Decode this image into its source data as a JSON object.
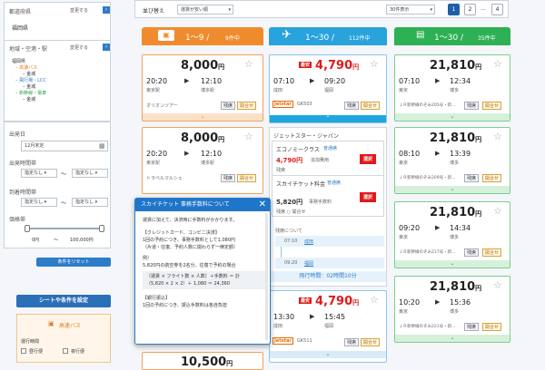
{
  "sidebar": {
    "dep_pref_label": "都道府県",
    "dep_change": "変更する",
    "dep_value": "福岡県",
    "area_label": "地域・空港・駅",
    "area_change": "変更する",
    "tree": [
      "福岡県",
      "高速バス",
      "金城",
      "飛行場・LCC",
      "金城",
      "新幹線・電車",
      "金城"
    ],
    "date_label": "出発日",
    "date_value": "12月末定",
    "dep_time_label": "出発時間帯",
    "arr_time_label": "到着時間帯",
    "none": "指定なし",
    "tilde": "〜",
    "price_label": "価格帯",
    "price_min": "0円",
    "price_max": "100,000円",
    "reset_button": "条件をリセット",
    "nav_button": "シートや条件を設定",
    "bus_section": "高速バス",
    "operating_label": "運行時間",
    "opt1": "昼行便",
    "opt2": "夜行便"
  },
  "toolbar": {
    "sort_label": "並び替え",
    "sort_value": "運賃が安い順",
    "per_page": "30件表示",
    "pages": [
      "1",
      "2",
      "4"
    ],
    "ellipsis": "…"
  },
  "columns": {
    "bus": {
      "range": "1〜9 /",
      "count": "9件中"
    },
    "air": {
      "range": "1〜30 /",
      "count": "112件中"
    },
    "train": {
      "range": "1〜30 /",
      "count": "35件中"
    }
  },
  "bus_cards": [
    {
      "price": "8,000",
      "yen": "円",
      "dep": "20:20",
      "arr": "12:10",
      "from": "東京駅",
      "to": "博多駅",
      "op": "オリオンツアー",
      "seat": "残席",
      "btn": "開合せ"
    },
    {
      "price": "8,000",
      "yen": "円",
      "dep": "20:20",
      "arr": "12:10",
      "from": "東京駅",
      "to": "博多駅",
      "op": "トラベルマルシェ",
      "seat": "残席",
      "btn": "開合せ"
    },
    {
      "price": "10,500",
      "yen": "円"
    }
  ],
  "air_cards": [
    {
      "badge": "最安",
      "price": "4,790",
      "yen": "円",
      "dep": "07:10",
      "arr": "09:20",
      "from": "成田",
      "to": "福岡",
      "airline": "Jetstar",
      "flight": "GK503",
      "seat": "残席",
      "btn": "開合せ"
    },
    {
      "badge": "最安",
      "price": "4,790",
      "yen": "円",
      "dep": "13:30",
      "arr": "15:45",
      "from": "成田",
      "to": "福岡",
      "airline": "Jetstar",
      "flight": "GK511",
      "seat": "残席",
      "btn": "開合せ"
    }
  ],
  "air_detail": {
    "company": "ジェットスター・ジャパン",
    "fare1_name": "エコノミークラス",
    "fare1_tag": "普通席",
    "fare1_price": "4,790円",
    "fare1_extra": "追加費用",
    "fare1_seat": "残席",
    "fare1_btn": "選択",
    "fare2_name": "スカイチケット料金",
    "fare2_tag": "普通席",
    "fare2_price": "5,820円",
    "fare2_extra": "事務手数料",
    "fare2_seat": "残席",
    "fare2_btn": "選択",
    "fare2_note": "残席 ○ 開合せ",
    "route_label": "残席について",
    "r1_time": "07:10",
    "r1_place": "成田",
    "r2_time": "09:20",
    "r2_place": "福岡",
    "duration": "飛行時間：02時間10分"
  },
  "train_cards": [
    {
      "price": "21,810",
      "yen": "円",
      "dep": "07:10",
      "arr": "12:34",
      "from": "東京",
      "to": "博多",
      "name": "ＪＲ新幹線のぞみ205号・新…",
      "seat": "残席",
      "btn": "開合せ"
    },
    {
      "price": "21,810",
      "yen": "円",
      "dep": "08:10",
      "arr": "13:39",
      "from": "東京",
      "to": "博多",
      "name": "ＪＲ新幹線のぞみ209号・新…",
      "seat": "残席",
      "btn": "開合せ"
    },
    {
      "price": "21,810",
      "yen": "円",
      "dep": "09:20",
      "arr": "14:34",
      "from": "東京",
      "to": "博多",
      "name": "ＪＲ新幹線のぞみ217号・新…",
      "seat": "残席",
      "btn": "開合せ"
    },
    {
      "price": "21,810",
      "yen": "円",
      "dep": "10:20",
      "arr": "15:36",
      "from": "東京",
      "to": "博多",
      "name": "ＪＲ新幹線のぞみ221号・新…",
      "seat": "残席",
      "btn": "開合せ"
    }
  ],
  "popup": {
    "title": "スカイチケット 事務手数料について",
    "lines": [
      "運賃に加えて、決済時に手数料がかかります。",
      "【クレジットカード、コンビニ決済】",
      "1回の予約につき、事務手数料として1,080円",
      "（片道・往復、予約人数に関わらず一律定額）",
      "例）",
      "5,820円の航空券を2名分、往復で予約の場合",
      "（運賃 × フライト数 × 人数）＋手数料 ＝ 計",
      "（5,820 × 2 × 2）＋ 1,080 ＝ 24,360",
      "【銀行振込】",
      "1回の予約につき、振込手数料は各自負担"
    ]
  }
}
